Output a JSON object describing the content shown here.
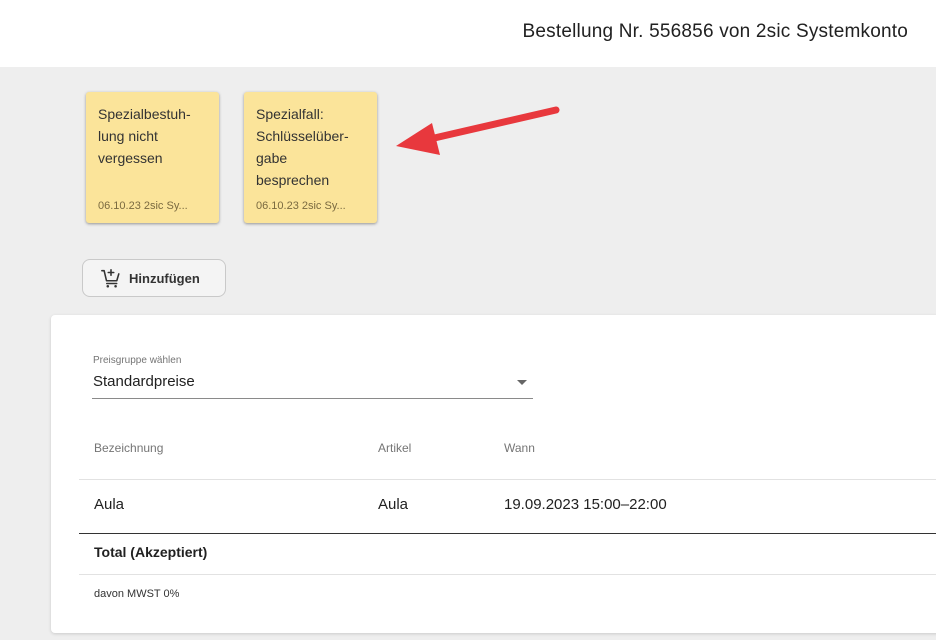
{
  "header": {
    "title": "Bestellung Nr. 556856 von 2sic Systemkonto"
  },
  "notes": [
    {
      "text": "Spezialbestuh-\nlung nicht\nvergessen",
      "meta": "06.10.23 2sic Sy..."
    },
    {
      "text": "Spezialfall:\nSchlüsselüber-\ngabe\nbesprechen",
      "meta": "06.10.23 2sic Sy..."
    }
  ],
  "toolbar": {
    "add_label": "Hinzufügen",
    "add_icon": "cart-plus-icon"
  },
  "annotation": {
    "arrow_icon": "red-arrow-icon",
    "arrow_color": "#e8383d"
  },
  "price_group": {
    "label": "Preisgruppe wählen",
    "value": "Standardpreise"
  },
  "table": {
    "columns": [
      "Bezeichnung",
      "Artikel",
      "Wann"
    ],
    "rows": [
      [
        "Aula",
        "Aula",
        "19.09.2023 15:00–22:00"
      ]
    ],
    "total_label": "Total (Akzeptiert)",
    "tax_label": "davon MWST 0%"
  },
  "colors": {
    "note_bg": "#fbe49a",
    "page_bg": "#eeeeee",
    "card_bg": "#ffffff"
  }
}
